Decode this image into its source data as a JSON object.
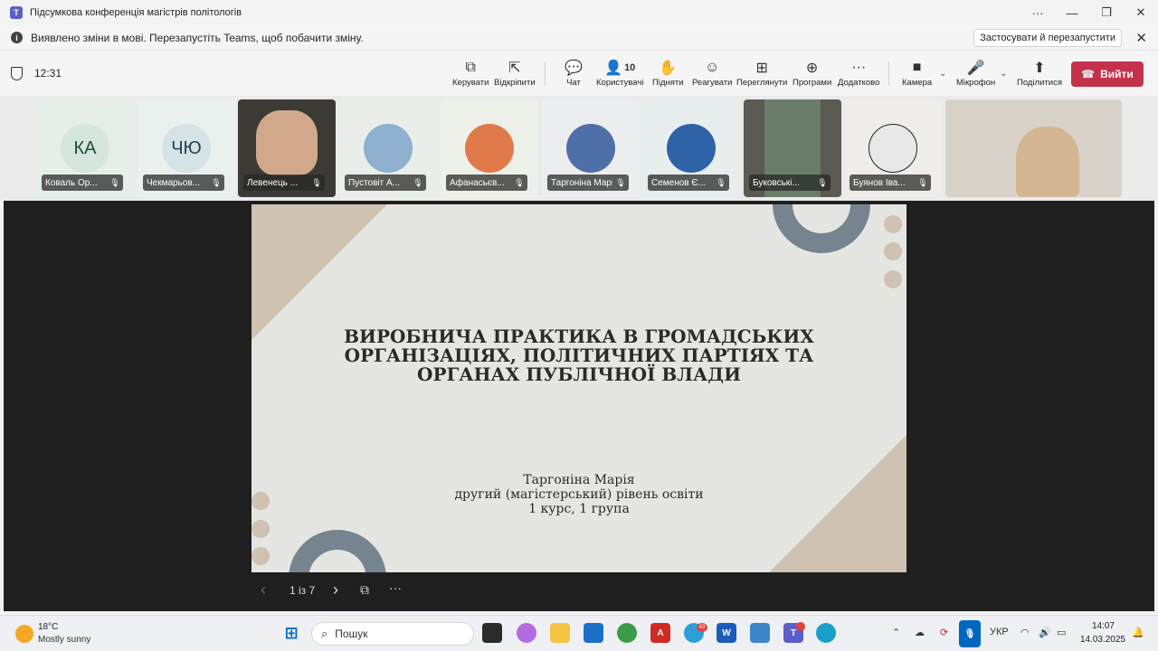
{
  "window": {
    "title": "Підсумкова конференція магістрів політологів",
    "more": "···",
    "minimize": "—",
    "restore": "❐",
    "close": "✕"
  },
  "notification": {
    "message": "Виявлено зміни в мові. Перезапустіть Teams, щоб побачити зміну.",
    "action": "Застосувати й перезапустити",
    "close": "✕"
  },
  "meeting": {
    "time": "12:31",
    "toolbar": {
      "control": "Керувати",
      "unpin": "Відкріпити",
      "chat": "Чат",
      "people": "Користувачі",
      "people_count": "10",
      "raise": "Підняти",
      "react": "Реагувати",
      "view": "Переглянути",
      "apps": "Програми",
      "more": "Додатково",
      "camera": "Камера",
      "mic": "Мікрофон",
      "share": "Поділитися",
      "leave": "Вийти"
    }
  },
  "participants": [
    {
      "name": "Коваль Ор...",
      "initials": "КА",
      "bg": "#e6eee9",
      "avatar": "#d5e6dc",
      "color": "#1f4d3a"
    },
    {
      "name": "Чекмарьов...",
      "initials": "ЧЮ",
      "bg": "#eaf0ee",
      "avatar": "#d5e2e6",
      "color": "#24424d"
    },
    {
      "name": "Левенець ...",
      "initials": "",
      "bg": "#3b3a35",
      "avatar": "#d2a88c",
      "color": "#000"
    },
    {
      "name": "Пустовіт А...",
      "initials": "",
      "bg": "#e9eee8",
      "avatar": "#8fb0cf",
      "color": "#000"
    },
    {
      "name": "Афанасьєв...",
      "initials": "",
      "bg": "#eef0ea",
      "avatar": "#e07a4a",
      "color": "#000"
    },
    {
      "name": "Таргоніна Марі...",
      "initials": "",
      "bg": "#ecedee",
      "avatar": "#4f6fa8",
      "color": "#000"
    },
    {
      "name": "Семенов Є...",
      "initials": "",
      "bg": "#e8eeee",
      "avatar": "#2e63a8",
      "color": "#000"
    },
    {
      "name": "Буковські...",
      "initials": "",
      "bg": "#5a5a52",
      "avatar": "#6b7d6a",
      "color": "#000"
    },
    {
      "name": "Буянов Іва...",
      "initials": "",
      "bg": "#eeedea",
      "avatar": "#e8e8e8",
      "color": "#000"
    },
    {
      "name": "",
      "initials": "",
      "bg": "#d9d2c9",
      "avatar": "#d4b694",
      "color": "#000"
    }
  ],
  "slide": {
    "title": "ВИРОБНИЧА ПРАКТИКА В ГРОМАДСЬКИХ ОРГАНІЗАЦІЯХ, ПОЛІТИЧНИХ ПАРТІЯХ ТА ОРГАНАХ ПУБЛІЧНОЇ ВЛАДИ",
    "author": "Таргоніна Марія",
    "level": "другий (магістерський) рівень освіти",
    "group": "1 курс, 1 група"
  },
  "pager": {
    "prev": "‹",
    "label": "1 із 7",
    "next": "›",
    "more": "···"
  },
  "taskbar": {
    "temp": "18°C",
    "weather": "Mostly sunny",
    "search": "Пошук",
    "lang": "УКР",
    "time": "14:07",
    "date": "14.03.2025",
    "telegram_badge": "43"
  }
}
